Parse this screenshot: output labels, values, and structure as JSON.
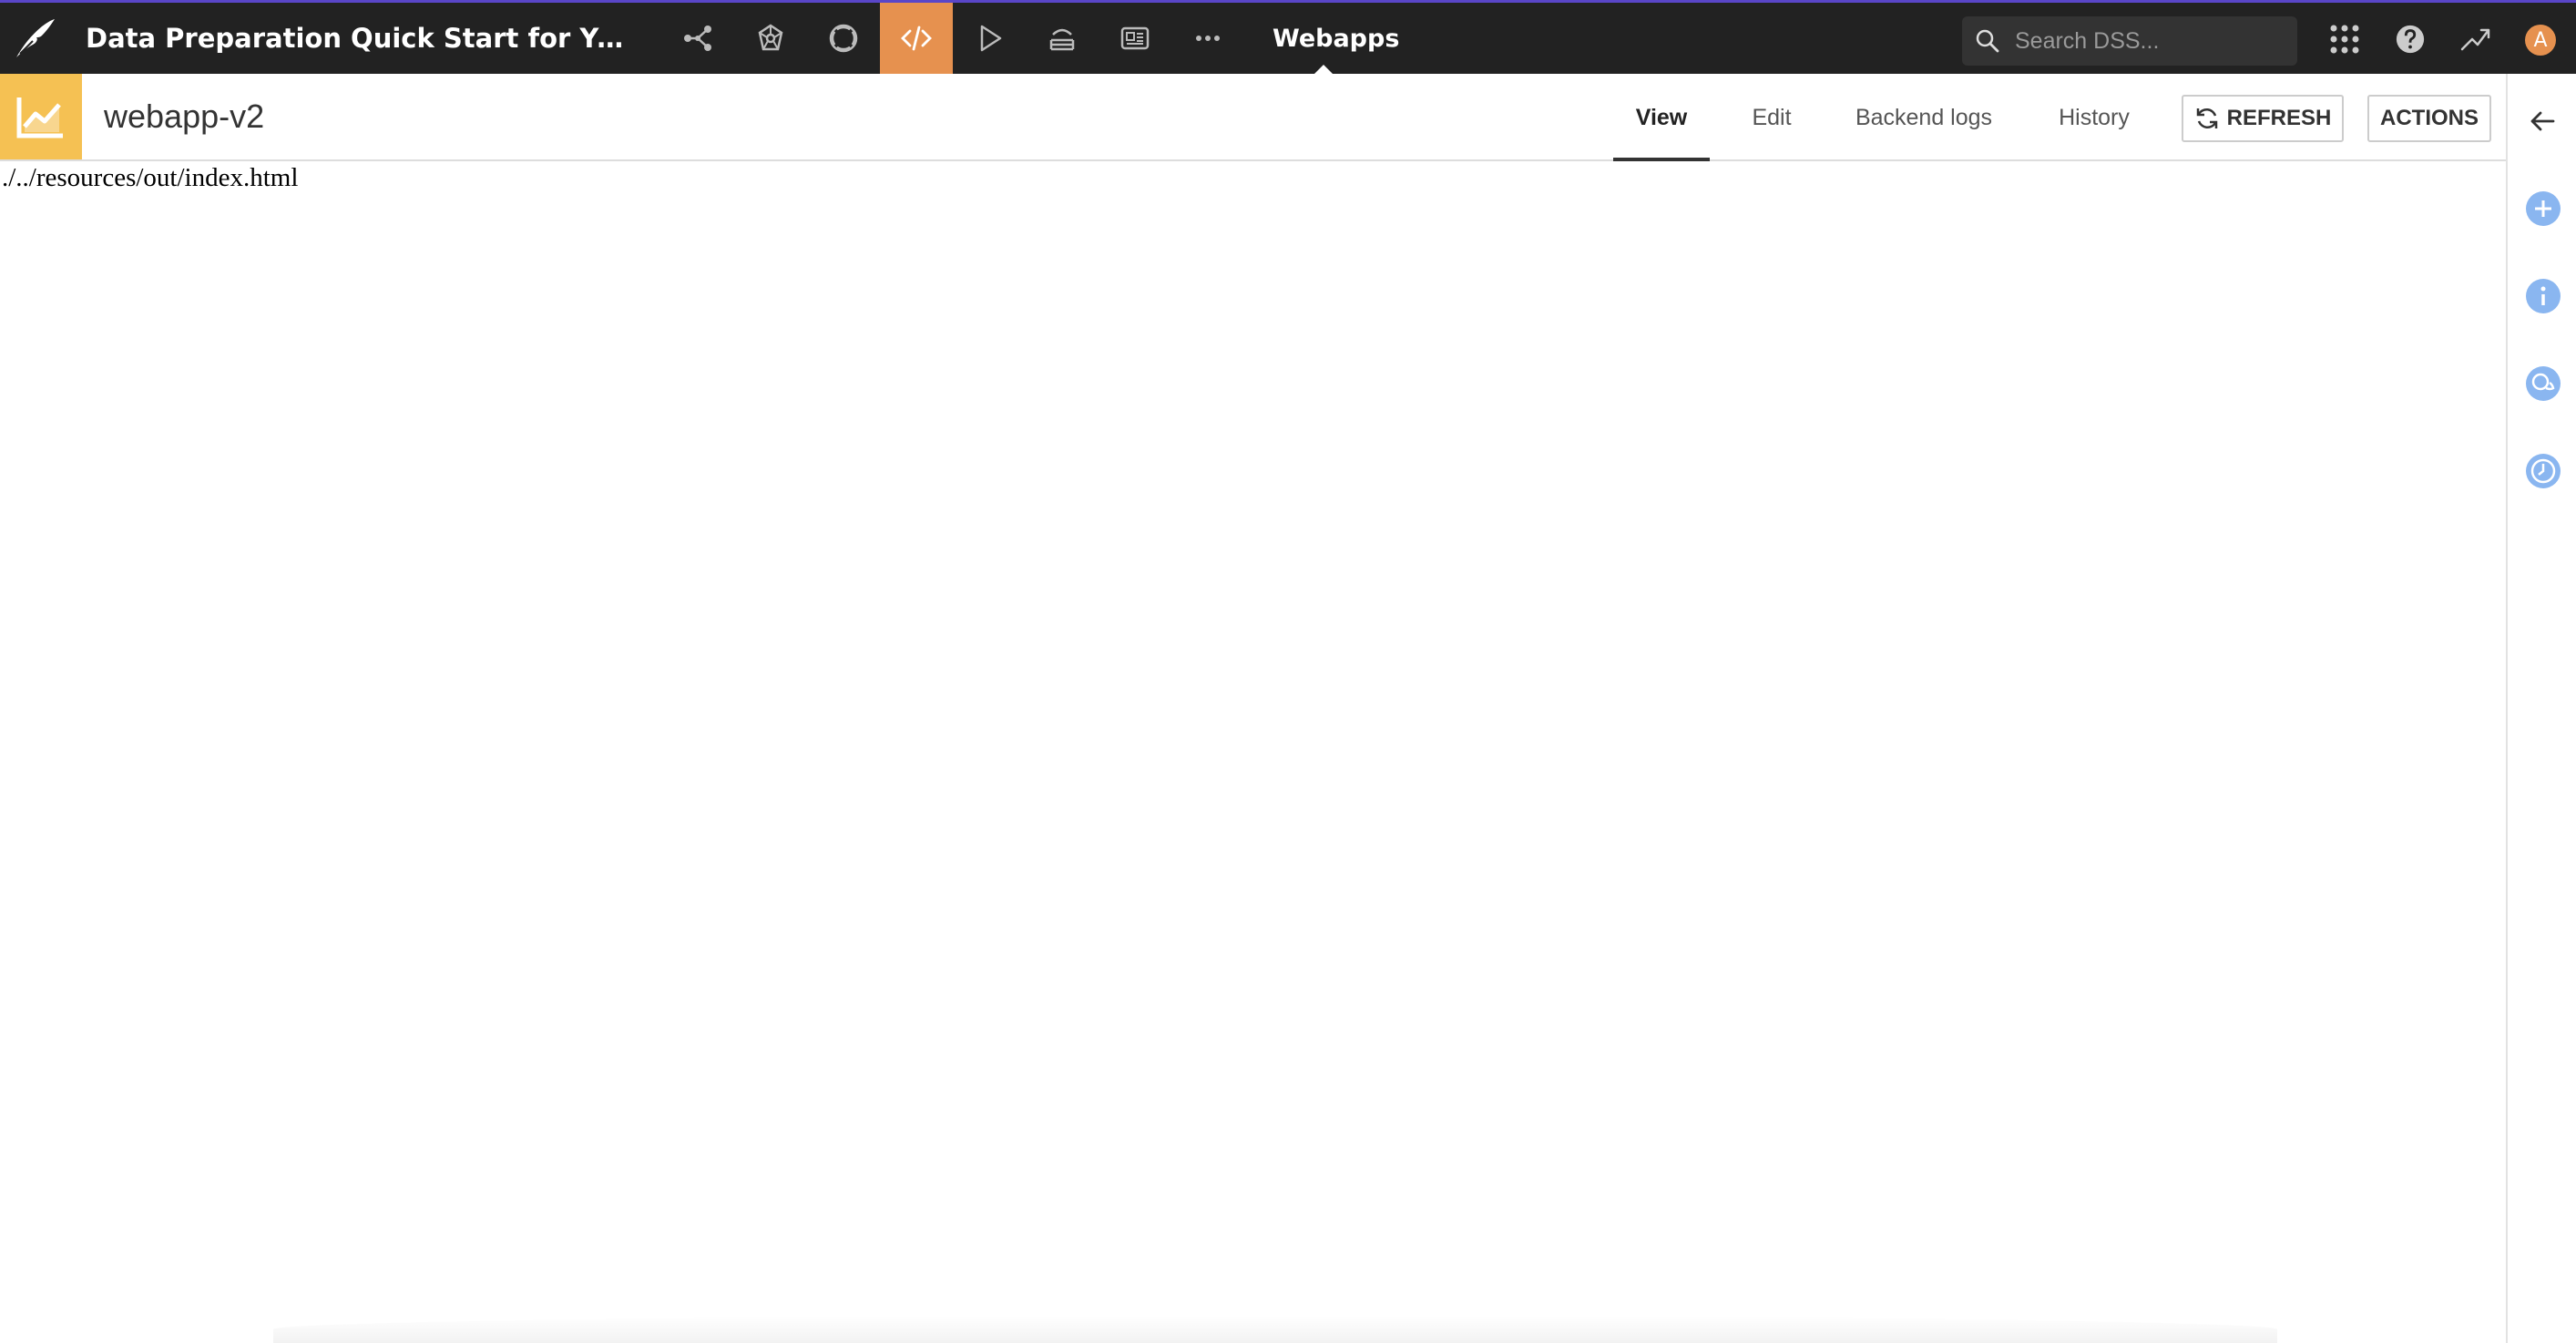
{
  "topbar": {
    "project_title": "Data Preparation Quick Start for Yusril Pr...",
    "section_label": "Webapps",
    "nav_icons": [
      "flow-icon",
      "lab-icon",
      "lifebuoy-icon",
      "code-icon",
      "play-icon",
      "stack-icon",
      "dashboard-icon",
      "more-icon"
    ],
    "active_nav_icon": "code-icon",
    "search": {
      "placeholder": "Search DSS..."
    },
    "avatar_initial": "A",
    "accent_color": "#e6914f",
    "brand_border_color": "#5a46c8"
  },
  "header": {
    "object_icon": "chart-line-icon",
    "object_icon_color": "#f5c153",
    "object_name": "webapp-v2",
    "tabs": [
      {
        "label": "View",
        "active": true
      },
      {
        "label": "Edit",
        "active": false
      },
      {
        "label": "Backend logs",
        "active": false
      },
      {
        "label": "History",
        "active": false
      }
    ],
    "refresh_label": "REFRESH",
    "actions_label": "ACTIONS"
  },
  "content": {
    "path_text": "./../resources/out/index.html"
  },
  "right_panel": {
    "icons": [
      "back-arrow-icon",
      "plus-circle-icon",
      "info-icon",
      "discussions-icon",
      "clock-icon"
    ],
    "icon_color": "#8ab6f0"
  }
}
